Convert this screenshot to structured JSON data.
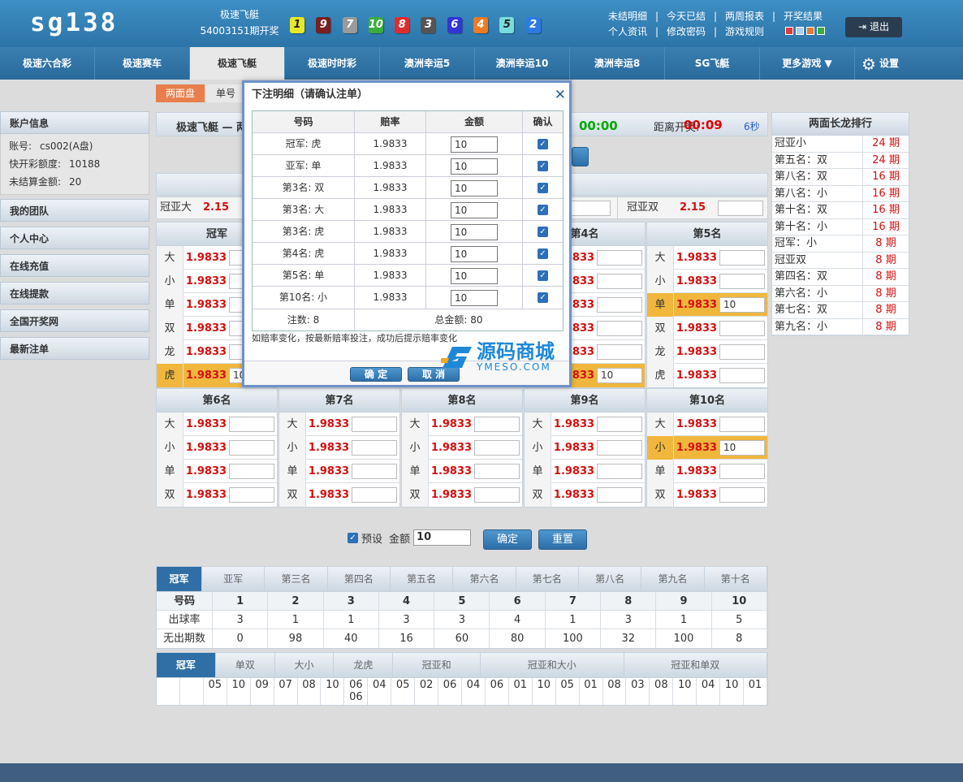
{
  "header": {
    "logo": "sg138",
    "game_name": "极速飞艇",
    "period": "54003151期开奖",
    "balls": [
      {
        "n": "1",
        "color": "#e8e82a"
      },
      {
        "n": "9",
        "color": "#7a1e1e"
      },
      {
        "n": "7",
        "color": "#9a9a9a"
      },
      {
        "n": "10",
        "color": "#3aad3a"
      },
      {
        "n": "8",
        "color": "#e02c2c"
      },
      {
        "n": "3",
        "color": "#555555"
      },
      {
        "n": "6",
        "color": "#3434d6"
      },
      {
        "n": "4",
        "color": "#ee7a24"
      },
      {
        "n": "5",
        "color": "#79dcdc"
      },
      {
        "n": "2",
        "color": "#2c7be0"
      }
    ],
    "links_row1": [
      "未结明细",
      "今天已结",
      "两周报表",
      "开奖结果"
    ],
    "links_row2": [
      "个人资讯",
      "修改密码",
      "游戏规则"
    ],
    "swatches": [
      "#e23a3a",
      "#aaccee",
      "#e87a2a",
      "#3aad3a"
    ],
    "logout": "退出"
  },
  "nav": {
    "tabs": [
      "极速六合彩",
      "极速赛车",
      "极速飞艇",
      "极速时时彩",
      "澳洲幸运5",
      "澳洲幸运10",
      "澳洲幸运8",
      "SG飞艇",
      "更多游戏 ▼"
    ],
    "active_index": 2,
    "settings": "设置"
  },
  "subtabs": [
    "两面盘",
    "单号"
  ],
  "sidebar": {
    "account_title": "账户信息",
    "account_lines": [
      {
        "label": "账号:",
        "value": "cs002(A盘)"
      },
      {
        "label": "快开彩额度:",
        "value": "10188"
      },
      {
        "label": "未结算金额:",
        "value": "20"
      }
    ],
    "items": [
      "我的团队",
      "个人中心",
      "在线充值",
      "在线提款",
      "全国开奖网",
      "最新注单"
    ]
  },
  "status": {
    "game": "极速飞艇 — 两",
    "timer": "00:00",
    "draw_label": "距离开奖:",
    "draw_timer": "00:09",
    "refresh": "6秒"
  },
  "sum_row": [
    {
      "label": "冠亚大",
      "odds": "2.15"
    },
    {
      "label": "冠亚双",
      "odds": "2.15"
    }
  ],
  "top_columns": [
    {
      "title": "冠军",
      "rows": [
        {
          "n": "大",
          "o": "1.9833",
          "v": "",
          "sel": false
        },
        {
          "n": "小",
          "o": "1.9833",
          "v": "",
          "sel": false
        },
        {
          "n": "单",
          "o": "1.9833",
          "v": "",
          "sel": false
        },
        {
          "n": "双",
          "o": "1.9833",
          "v": "",
          "sel": false
        },
        {
          "n": "龙",
          "o": "1.9833",
          "v": "",
          "sel": false
        },
        {
          "n": "虎",
          "o": "1.9833",
          "v": "10",
          "sel": true
        }
      ]
    },
    {
      "title": "第4名",
      "rows": [
        {
          "n": "大",
          "o": "1.9833",
          "v": "",
          "sel": false
        },
        {
          "n": "小",
          "o": "1.9833",
          "v": "",
          "sel": false
        },
        {
          "n": "单",
          "o": "1.9833",
          "v": "",
          "sel": false
        },
        {
          "n": "双",
          "o": "1.9833",
          "v": "",
          "sel": false
        },
        {
          "n": "龙",
          "o": "1.9833",
          "v": "",
          "sel": false
        },
        {
          "n": "虎",
          "o": "1.9833",
          "v": "10",
          "sel": true
        }
      ]
    },
    {
      "title": "第5名",
      "rows": [
        {
          "n": "大",
          "o": "1.9833",
          "v": "",
          "sel": false
        },
        {
          "n": "小",
          "o": "1.9833",
          "v": "",
          "sel": false
        },
        {
          "n": "单",
          "o": "1.9833",
          "v": "10",
          "sel": true
        },
        {
          "n": "双",
          "o": "1.9833",
          "v": "",
          "sel": false
        },
        {
          "n": "龙",
          "o": "1.9833",
          "v": "",
          "sel": false
        },
        {
          "n": "虎",
          "o": "1.9833",
          "v": "",
          "sel": false
        }
      ]
    }
  ],
  "bottom_columns": [
    {
      "title": "第6名",
      "rows": [
        {
          "n": "大",
          "o": "1.9833",
          "v": "",
          "sel": false
        },
        {
          "n": "小",
          "o": "1.9833",
          "v": "",
          "sel": false
        },
        {
          "n": "单",
          "o": "1.9833",
          "v": "",
          "sel": false
        },
        {
          "n": "双",
          "o": "1.9833",
          "v": "",
          "sel": false
        }
      ]
    },
    {
      "title": "第7名",
      "rows": [
        {
          "n": "大",
          "o": "1.9833",
          "v": "",
          "sel": false
        },
        {
          "n": "小",
          "o": "1.9833",
          "v": "",
          "sel": false
        },
        {
          "n": "单",
          "o": "1.9833",
          "v": "",
          "sel": false
        },
        {
          "n": "双",
          "o": "1.9833",
          "v": "",
          "sel": false
        }
      ]
    },
    {
      "title": "第8名",
      "rows": [
        {
          "n": "大",
          "o": "1.9833",
          "v": "",
          "sel": false
        },
        {
          "n": "小",
          "o": "1.9833",
          "v": "",
          "sel": false
        },
        {
          "n": "单",
          "o": "1.9833",
          "v": "",
          "sel": false
        },
        {
          "n": "双",
          "o": "1.9833",
          "v": "",
          "sel": false
        }
      ]
    },
    {
      "title": "第9名",
      "rows": [
        {
          "n": "大",
          "o": "1.9833",
          "v": "",
          "sel": false
        },
        {
          "n": "小",
          "o": "1.9833",
          "v": "",
          "sel": false
        },
        {
          "n": "单",
          "o": "1.9833",
          "v": "",
          "sel": false
        },
        {
          "n": "双",
          "o": "1.9833",
          "v": "",
          "sel": false
        }
      ]
    },
    {
      "title": "第10名",
      "rows": [
        {
          "n": "大",
          "o": "1.9833",
          "v": "",
          "sel": false
        },
        {
          "n": "小",
          "o": "1.9833",
          "v": "10",
          "sel": true
        },
        {
          "n": "单",
          "o": "1.9833",
          "v": "",
          "sel": false
        },
        {
          "n": "双",
          "o": "1.9833",
          "v": "",
          "sel": false
        }
      ]
    }
  ],
  "long_dragon": {
    "title": "两面长龙排行",
    "unit": "期",
    "rows": [
      {
        "k": "冠亚小",
        "v": "24"
      },
      {
        "k": "第五名：双",
        "v": "24"
      },
      {
        "k": "第八名：双",
        "v": "16"
      },
      {
        "k": "第八名：小",
        "v": "16"
      },
      {
        "k": "第十名：双",
        "v": "16"
      },
      {
        "k": "第十名：小",
        "v": "16"
      },
      {
        "k": "冠军：小",
        "v": "8"
      },
      {
        "k": "冠亚双",
        "v": "8"
      },
      {
        "k": "第四名：双",
        "v": "8"
      },
      {
        "k": "第六名：小",
        "v": "8"
      },
      {
        "k": "第七名：双",
        "v": "8"
      },
      {
        "k": "第九名：小",
        "v": "8"
      }
    ]
  },
  "preset": {
    "label": "预设",
    "amount_label": "金额",
    "amount": "10",
    "confirm": "确定",
    "reset": "重置"
  },
  "stats": {
    "tabs": [
      "冠军",
      "亚军",
      "第三名",
      "第四名",
      "第五名",
      "第六名",
      "第七名",
      "第八名",
      "第九名",
      "第十名"
    ],
    "header": [
      "号码",
      "1",
      "2",
      "3",
      "4",
      "5",
      "6",
      "7",
      "8",
      "9",
      "10"
    ],
    "rate_row": [
      "出球率",
      "3",
      "1",
      "1",
      "3",
      "3",
      "4",
      "1",
      "3",
      "1",
      "5"
    ],
    "miss_row": [
      "无出期数",
      "0",
      "98",
      "40",
      "16",
      "60",
      "80",
      "100",
      "32",
      "100",
      "8"
    ]
  },
  "stats2": {
    "tabs": [
      "冠军",
      "单双",
      "大小",
      "龙虎",
      "冠亚和",
      "冠亚和大小",
      "冠亚和单双"
    ],
    "cells": [
      [
        "",
        ""
      ],
      [
        "",
        ""
      ],
      [
        "05",
        ""
      ],
      [
        "10",
        ""
      ],
      [
        "09",
        ""
      ],
      [
        "07",
        ""
      ],
      [
        "08",
        ""
      ],
      [
        "10",
        ""
      ],
      [
        "06",
        "06"
      ],
      [
        "04",
        ""
      ],
      [
        "05",
        ""
      ],
      [
        "02",
        ""
      ],
      [
        "06",
        ""
      ],
      [
        "04",
        ""
      ],
      [
        "06",
        ""
      ],
      [
        "01",
        ""
      ],
      [
        "10",
        ""
      ],
      [
        "05",
        ""
      ],
      [
        "01",
        ""
      ],
      [
        "08",
        ""
      ],
      [
        "03",
        ""
      ],
      [
        "08",
        ""
      ],
      [
        "10",
        ""
      ],
      [
        "04",
        ""
      ],
      [
        "10",
        ""
      ],
      [
        "01",
        ""
      ]
    ]
  },
  "modal": {
    "title": "下注明细（请确认注单）",
    "columns": [
      "号码",
      "赔率",
      "金额",
      "确认"
    ],
    "rows": [
      {
        "k": "冠军: 虎",
        "o": "1.9833",
        "a": "10"
      },
      {
        "k": "亚军: 单",
        "o": "1.9833",
        "a": "10"
      },
      {
        "k": "第3名: 双",
        "o": "1.9833",
        "a": "10"
      },
      {
        "k": "第3名: 大",
        "o": "1.9833",
        "a": "10"
      },
      {
        "k": "第3名: 虎",
        "o": "1.9833",
        "a": "10"
      },
      {
        "k": "第4名: 虎",
        "o": "1.9833",
        "a": "10"
      },
      {
        "k": "第5名: 单",
        "o": "1.9833",
        "a": "10"
      },
      {
        "k": "第10名: 小",
        "o": "1.9833",
        "a": "10"
      }
    ],
    "count_label": "注数: 8",
    "total_label": "总金额: 80",
    "note": "如赔率变化，按最新赔率投注，成功后提示赔率变化",
    "confirm": "确 定",
    "cancel": "取 消"
  },
  "watermark": {
    "cn": "源码商城",
    "en": "YMESO.COM"
  }
}
